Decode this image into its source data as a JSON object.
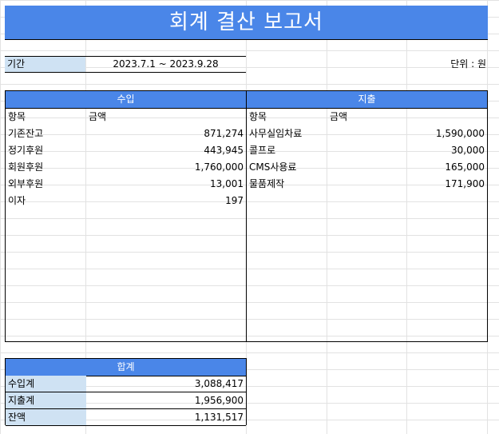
{
  "title": "회계 결산 보고서",
  "period": {
    "label": "기간",
    "value": "2023.7.1 ~ 2023.9.28"
  },
  "unit": "단위 : 원",
  "income": {
    "header": "수입",
    "col_item": "항목",
    "col_amount": "금액",
    "rows": [
      {
        "item": "기존잔고",
        "amount": "871,274"
      },
      {
        "item": "정기후원",
        "amount": "443,945"
      },
      {
        "item": "회원후원",
        "amount": "1,760,000"
      },
      {
        "item": "외부후원",
        "amount": "13,001"
      },
      {
        "item": "이자",
        "amount": "197"
      }
    ]
  },
  "expense": {
    "header": "지출",
    "col_item": "항목",
    "col_amount": "금액",
    "rows": [
      {
        "item": "사무실임차료",
        "amount": "1,590,000"
      },
      {
        "item": "콜프로",
        "amount": "30,000"
      },
      {
        "item": "CMS사용료",
        "amount": "165,000"
      },
      {
        "item": "물품제작",
        "amount": "171,900"
      }
    ]
  },
  "summary": {
    "header": "합계",
    "rows": [
      {
        "label": "수입계",
        "value": "3,088,417"
      },
      {
        "label": "지출계",
        "value": "1,956,900"
      },
      {
        "label": "잔액",
        "value": "1,131,517"
      }
    ]
  },
  "colors": {
    "header_blue": "#4a86e8",
    "label_blue": "#cfe2f3",
    "grid": "#e2e2e2"
  }
}
